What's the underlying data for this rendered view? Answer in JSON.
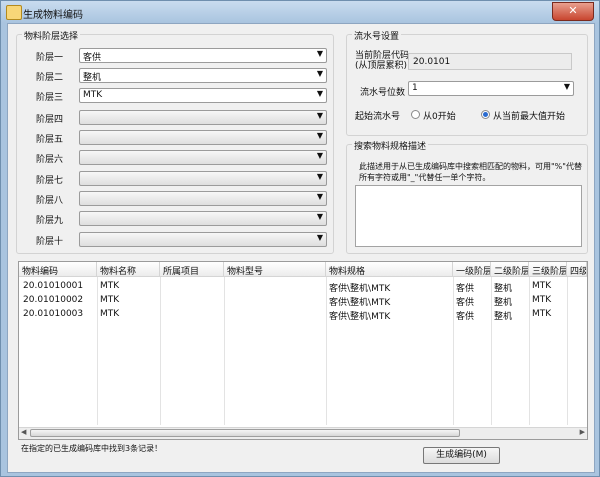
{
  "window": {
    "title": "生成物料编码",
    "close_label": "✕"
  },
  "levels_group": {
    "label": "物料阶层选择",
    "rows": [
      {
        "label": "阶层一",
        "value": "客供"
      },
      {
        "label": "阶层二",
        "value": "整机"
      },
      {
        "label": "阶层三",
        "value": "MTK"
      },
      {
        "label": "阶层四",
        "value": ""
      },
      {
        "label": "阶层五",
        "value": ""
      },
      {
        "label": "阶层六",
        "value": ""
      },
      {
        "label": "阶层七",
        "value": ""
      },
      {
        "label": "阶层八",
        "value": ""
      },
      {
        "label": "阶层九",
        "value": ""
      },
      {
        "label": "阶层十",
        "value": ""
      }
    ]
  },
  "serial_group": {
    "label": "流水号设置",
    "code_label_line1": "当前阶层代码",
    "code_label_line2": "(从顶层累积)",
    "code_value": "20.0101",
    "digits_label": "流水号位数",
    "digits_value": "1",
    "start_label": "起始流水号",
    "radio_zero": "从0开始",
    "radio_max": "从当前最大值开始",
    "selected": "radio_max"
  },
  "search_group": {
    "label": "搜索物料规格描述",
    "help_text": "此描述用于从已生成编码库中搜索相匹配的物料，可用\"%\"代替所有字符或用\"_\"代替任一单个字符。",
    "input_value": ""
  },
  "grid": {
    "columns": [
      "物料编码",
      "物料名称",
      "所属项目",
      "物料型号",
      "物料规格",
      "一级阶层",
      "二级阶层",
      "三级阶层",
      "四级"
    ],
    "rows": [
      [
        "20.01010001",
        "MTK",
        "",
        "",
        "客供\\整机\\MTK",
        "客供",
        "整机",
        "MTK"
      ],
      [
        "20.01010002",
        "MTK",
        "",
        "",
        "客供\\整机\\MTK",
        "客供",
        "整机",
        "MTK"
      ],
      [
        "20.01010003",
        "MTK",
        "",
        "",
        "客供\\整机\\MTK",
        "客供",
        "整机",
        "MTK"
      ]
    ]
  },
  "status_text": "在指定的已生成编码库中找到3条记录！",
  "generate_button": "生成编码(M)"
}
